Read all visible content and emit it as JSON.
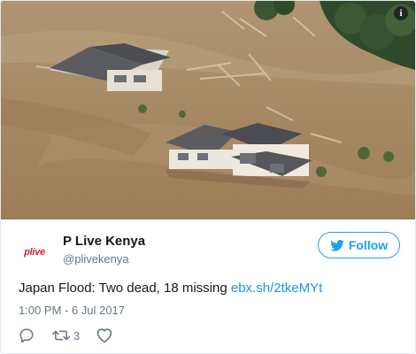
{
  "media": {
    "alt": "",
    "info_icon": "info-icon",
    "info_label": "i"
  },
  "author": {
    "avatar_text": "plive",
    "name": "P Live Kenya",
    "handle": "@plivekenya"
  },
  "follow_button": {
    "icon": "twitter-bird-icon",
    "label": "Follow"
  },
  "tweet": {
    "text": "Japan Flood: Two dead, 18 missing ",
    "link": "ebx.sh/2tkeMYt",
    "timestamp": "1:00 PM - 6 Jul 2017"
  },
  "actions": {
    "reply_icon": "reply-icon",
    "retweet_icon": "retweet-icon",
    "retweet_count": "3",
    "like_icon": "heart-icon"
  },
  "colors": {
    "accent": "#1da1f2",
    "link": "#1b95e0",
    "muted": "#657786",
    "text": "#14171a",
    "flood_water": "#a88b64"
  }
}
